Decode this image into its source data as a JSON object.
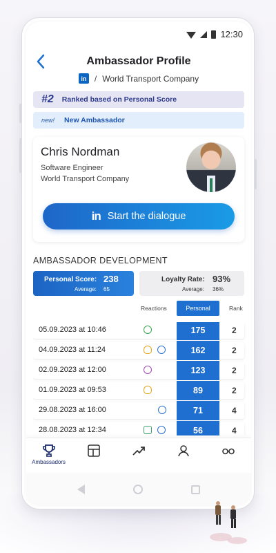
{
  "status_bar": {
    "time": "12:30"
  },
  "header": {
    "title": "Ambassador Profile",
    "linkedin_glyph": "in",
    "separator": "/",
    "company": "World Transport Company"
  },
  "badges": {
    "rank_number": "#2",
    "rank_text": "Ranked based on Personal Score",
    "new_tag": "new!",
    "new_text": "New Ambassador"
  },
  "profile": {
    "name": "Chris Nordman",
    "role": "Software Engineer",
    "company": "World Transport Company",
    "cta_glyph": "in",
    "cta_label": "Start the dialogue"
  },
  "development": {
    "title": "AMBASSADOR DEVELOPMENT",
    "personal_score_label": "Personal Score:",
    "personal_score_value": "238",
    "personal_avg_label": "Average:",
    "personal_avg_value": "65",
    "loyalty_label": "Loyalty Rate:",
    "loyalty_value": "93%",
    "loyalty_avg_label": "Average:",
    "loyalty_avg_value": "36%"
  },
  "table": {
    "headers": {
      "reactions": "Reactions",
      "personal": "Personal",
      "rank": "Rank"
    },
    "rows": [
      {
        "date": "05.09.2023 at 10:46",
        "reactions": [
          "clap-icon"
        ],
        "personal": "175",
        "rank": "2"
      },
      {
        "date": "04.09.2023 at 11:24",
        "reactions": [
          "idea-icon",
          "comment-icon"
        ],
        "personal": "162",
        "rank": "2"
      },
      {
        "date": "02.09.2023 at 12:00",
        "reactions": [
          "love-icon"
        ],
        "personal": "123",
        "rank": "2"
      },
      {
        "date": "01.09.2023 at 09:53",
        "reactions": [
          "idea-icon"
        ],
        "personal": "89",
        "rank": "2"
      },
      {
        "date": "29.08.2023 at 16:00",
        "reactions": [
          "comment-icon"
        ],
        "personal": "71",
        "rank": "4"
      },
      {
        "date": "28.08.2023 at 12:34",
        "reactions": [
          "support-icon",
          "comment-icon"
        ],
        "personal": "56",
        "rank": "4"
      }
    ]
  },
  "bottom_nav": [
    {
      "icon": "trophy-icon",
      "label": "Ambassadors",
      "active": true
    },
    {
      "icon": "layout-icon",
      "label": ""
    },
    {
      "icon": "trend-icon",
      "label": ""
    },
    {
      "icon": "user-icon",
      "label": ""
    },
    {
      "icon": "glasses-icon",
      "label": ""
    }
  ],
  "colors": {
    "accent": "#1f6fd0",
    "brand_dark": "#1a2a6c",
    "linkedin": "#0a66c2"
  }
}
